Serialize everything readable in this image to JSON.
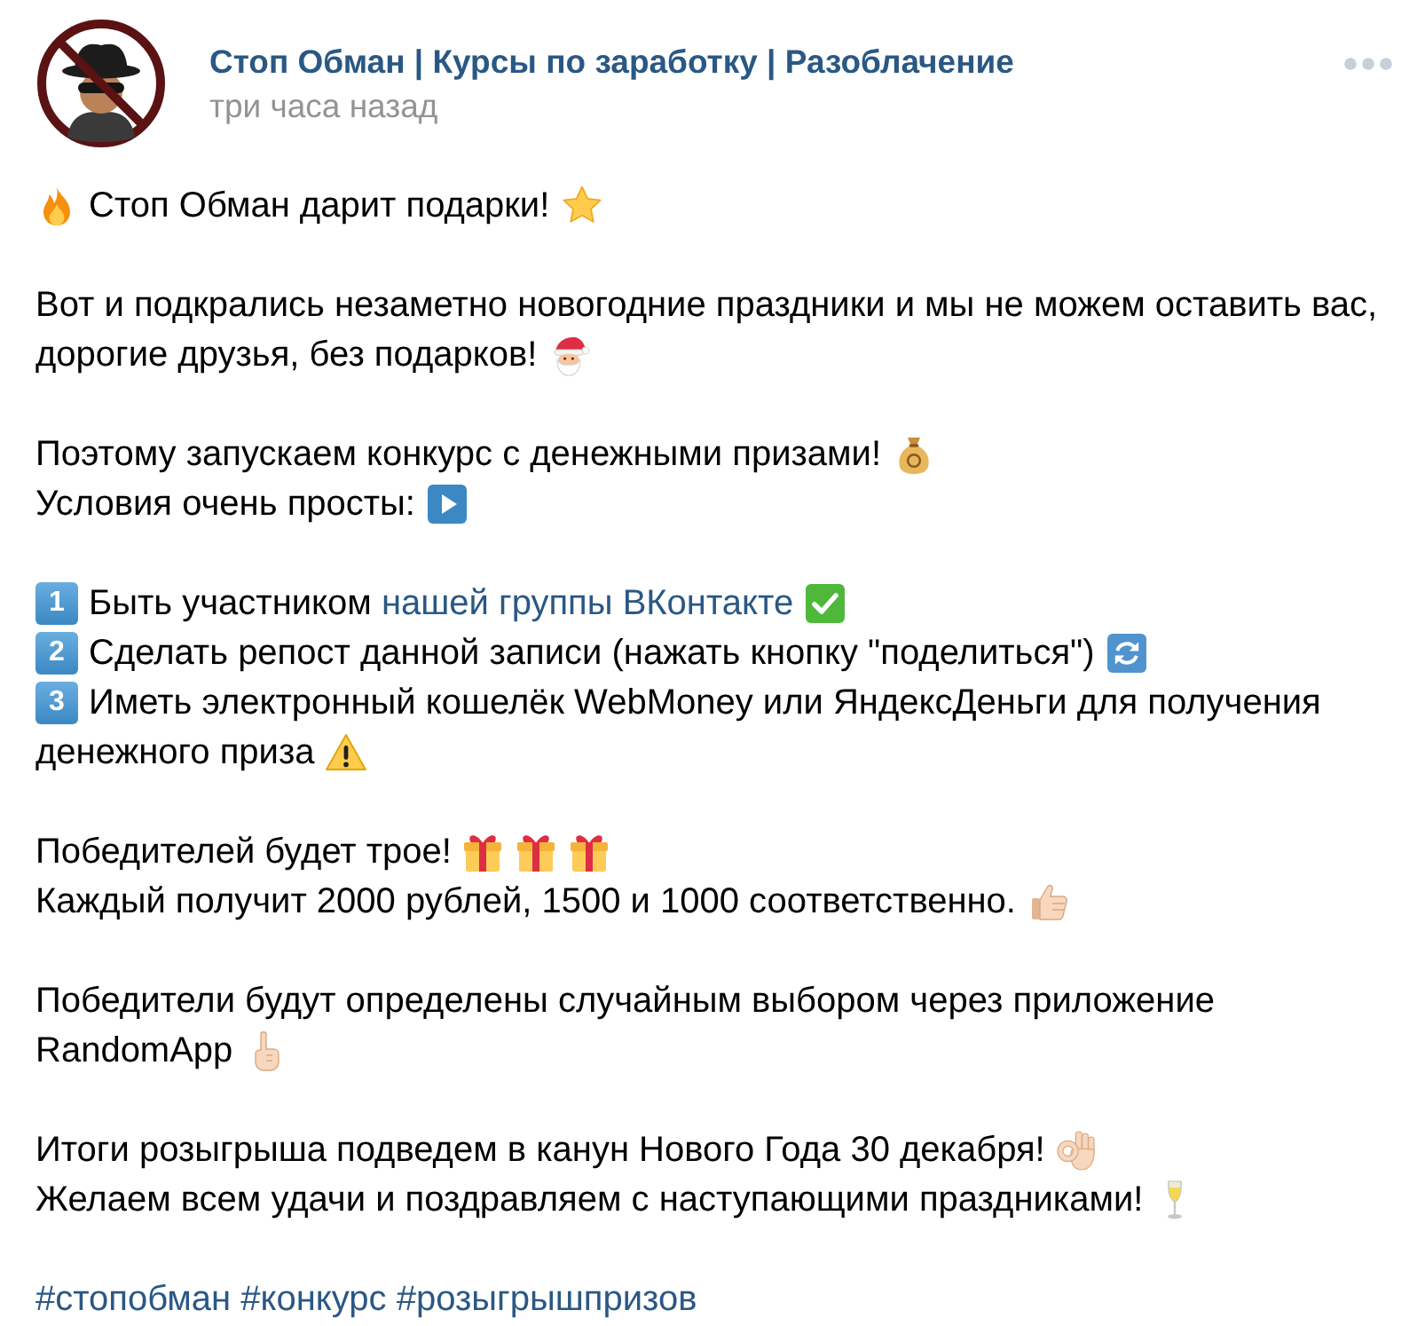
{
  "post": {
    "author": "Стоп Обман | Курсы по заработку | Разоблачение",
    "time": "три часа назад"
  },
  "paragraphs": [
    {
      "lines": [
        [
          {
            "kind": "fire"
          },
          {
            "kind": "text",
            "text": "Стоп Обман дарит подарки!"
          },
          {
            "kind": "star"
          }
        ]
      ]
    },
    {
      "lines": [
        [
          {
            "kind": "text",
            "text": "Вот и подкрались незаметно новогодние праздники и мы не можем оставить вас, дорогие друзья, без подарков!"
          },
          {
            "kind": "santa"
          }
        ]
      ]
    },
    {
      "lines": [
        [
          {
            "kind": "text",
            "text": "Поэтому запускаем конкурс с денежными призами!"
          },
          {
            "kind": "money-bag"
          }
        ],
        [
          {
            "kind": "text",
            "text": "Условия очень просты:"
          },
          {
            "kind": "play"
          }
        ]
      ]
    },
    {
      "lines": [
        [
          {
            "kind": "keycap",
            "text": "1"
          },
          {
            "kind": "text",
            "text": "Быть участником"
          },
          {
            "kind": "link",
            "text": "нашей группы ВКонтакте"
          },
          {
            "kind": "check"
          }
        ],
        [
          {
            "kind": "keycap",
            "text": "2"
          },
          {
            "kind": "text",
            "text": "Сделать репост данной записи (нажать кнопку \"поделиться\")"
          },
          {
            "kind": "refresh"
          }
        ],
        [
          {
            "kind": "keycap",
            "text": "3"
          },
          {
            "kind": "text",
            "text": "Иметь электронный кошелёк WebMoney или ЯндексДеньги для получения денежного приза"
          },
          {
            "kind": "warning"
          }
        ]
      ]
    },
    {
      "lines": [
        [
          {
            "kind": "text",
            "text": "Победителей будет трое!"
          },
          {
            "kind": "gift"
          },
          {
            "kind": "gift"
          },
          {
            "kind": "gift"
          }
        ],
        [
          {
            "kind": "text",
            "text": "Каждый получит 2000 рублей, 1500 и 1000 соответственно."
          },
          {
            "kind": "thumbs-up"
          }
        ]
      ]
    },
    {
      "lines": [
        [
          {
            "kind": "text",
            "text": "Победители будут определены случайным выбором через приложение RandomApp"
          },
          {
            "kind": "point-up"
          }
        ]
      ]
    },
    {
      "lines": [
        [
          {
            "kind": "text",
            "text": "Итоги розыгрыша подведем в канун Нового Года 30 декабря!"
          },
          {
            "kind": "ok-hand"
          }
        ],
        [
          {
            "kind": "text",
            "text": "Желаем всем удачи и поздравляем с наступающими праздниками!"
          },
          {
            "kind": "champagne"
          }
        ]
      ]
    },
    {
      "lines": [
        [
          {
            "kind": "link",
            "text": "#стопобман"
          },
          {
            "kind": "link",
            "text": "#конкурс"
          },
          {
            "kind": "link",
            "text": "#розыгрышпризов"
          }
        ]
      ]
    }
  ]
}
